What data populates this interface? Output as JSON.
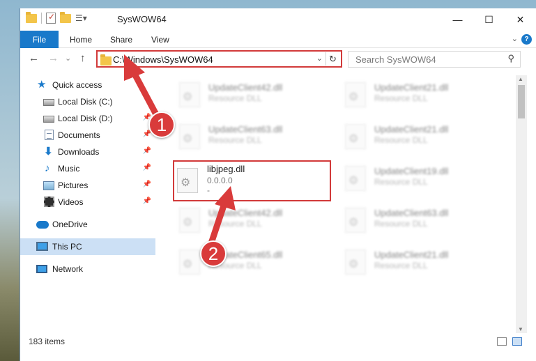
{
  "window": {
    "title": "SysWOW64",
    "controls": {
      "minimize": "—",
      "maximize": "☐",
      "close": "✕"
    }
  },
  "ribbon": {
    "file_tab": "File",
    "tabs": [
      "Home",
      "Share",
      "View"
    ],
    "help": "?"
  },
  "navbar": {
    "back": "←",
    "forward": "→",
    "recent": "⌄",
    "up": "↑",
    "address": "C:\\Windows\\SysWOW64",
    "search_placeholder": "Search SysWOW64"
  },
  "sidebar": {
    "items": [
      {
        "label": "Quick access",
        "icon": "star-icon",
        "pinned": false
      },
      {
        "label": "Local Disk (C:)",
        "icon": "disk-icon",
        "pinned": false
      },
      {
        "label": "Local Disk (D:)",
        "icon": "disk-icon",
        "pinned": true
      },
      {
        "label": "Documents",
        "icon": "documents-icon",
        "pinned": true
      },
      {
        "label": "Downloads",
        "icon": "downloads-icon",
        "pinned": true
      },
      {
        "label": "Music",
        "icon": "music-icon",
        "pinned": true
      },
      {
        "label": "Pictures",
        "icon": "pictures-icon",
        "pinned": true
      },
      {
        "label": "Videos",
        "icon": "videos-icon",
        "pinned": true
      },
      {
        "label": "OneDrive",
        "icon": "cloud-icon",
        "pinned": false
      },
      {
        "label": "This PC",
        "icon": "computer-icon",
        "pinned": false,
        "selected": true
      },
      {
        "label": "Network",
        "icon": "network-icon",
        "pinned": false
      }
    ]
  },
  "files": [
    {
      "name": "UpdateClient42.dll",
      "type": "Resource DLL"
    },
    {
      "name": "UpdateClient21.dll",
      "type": "Resource DLL"
    },
    {
      "name": "UpdateClient63.dll",
      "type": "Resource DLL"
    },
    {
      "name": "UpdateClient21.dll",
      "type": "Resource DLL"
    },
    {
      "name": "libjpeg.dll",
      "type": "0.0.0.0",
      "extra": "-"
    },
    {
      "name": "UpdateClient19.dll",
      "type": "Resource DLL"
    },
    {
      "name": "UpdateClient42.dll",
      "type": "Resource DLL"
    },
    {
      "name": "UpdateClient63.dll",
      "type": "Resource DLL"
    },
    {
      "name": "UpdateClient65.dll",
      "type": "Resource DLL"
    },
    {
      "name": "UpdateClient21.dll",
      "type": "Resource DLL"
    }
  ],
  "status": {
    "item_count": "183 items"
  },
  "callouts": {
    "one": "1",
    "two": "2"
  },
  "colors": {
    "accent": "#1979ca",
    "highlight": "#d23a3a",
    "selected": "#cce0f5"
  }
}
